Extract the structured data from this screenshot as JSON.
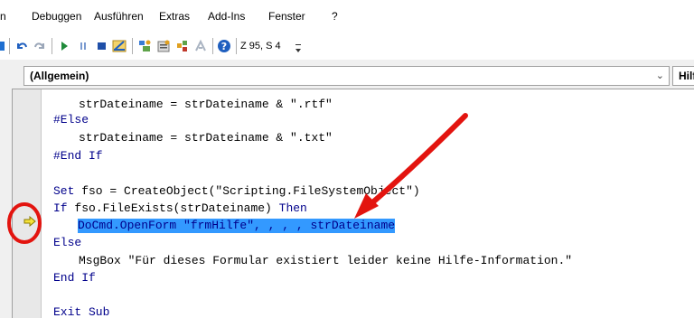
{
  "menu": [
    "n",
    "Debuggen",
    "Ausführen",
    "Extras",
    "Add-Ins",
    "Fenster",
    "?"
  ],
  "toolbar": {
    "position_label": "Z 95, S 4",
    "icons": [
      "insert-icon",
      "undo-icon",
      "redo-icon",
      "run-icon",
      "break-icon",
      "reset-icon",
      "design-mode-icon",
      "project-explorer-icon",
      "properties-icon",
      "object-browser-icon",
      "toolbox-icon",
      "help-icon"
    ]
  },
  "combos": {
    "object": "(Allgemein)",
    "procedure": "Hilfe/"
  },
  "code": {
    "line1": "strDateiname = strDateiname & \".rtf\"",
    "line2": "#Else",
    "line3": "strDateiname = strDateiname & \".txt\"",
    "line4": "#End If",
    "line5_kw": "Set",
    "line5_rest": " fso = CreateObject(\"Scripting.FileSystemObject\")",
    "line6_kw": "If",
    "line6_rest": " fso.FileExists(strDateiname) ",
    "line6_kw2": "Then",
    "line7": "DoCmd.OpenForm \"frmHilfe\", , , , strDateiname",
    "line8": "Else",
    "line9": "MsgBox \"Für dieses Formular existiert leider keine Hilfe-Information.\"",
    "line10": "End If",
    "line11": "Exit Sub"
  },
  "colors": {
    "keyword": "#00008b",
    "selection": "#3399ff",
    "annotation": "#e3140f",
    "execution_arrow": "#f5e33a"
  }
}
